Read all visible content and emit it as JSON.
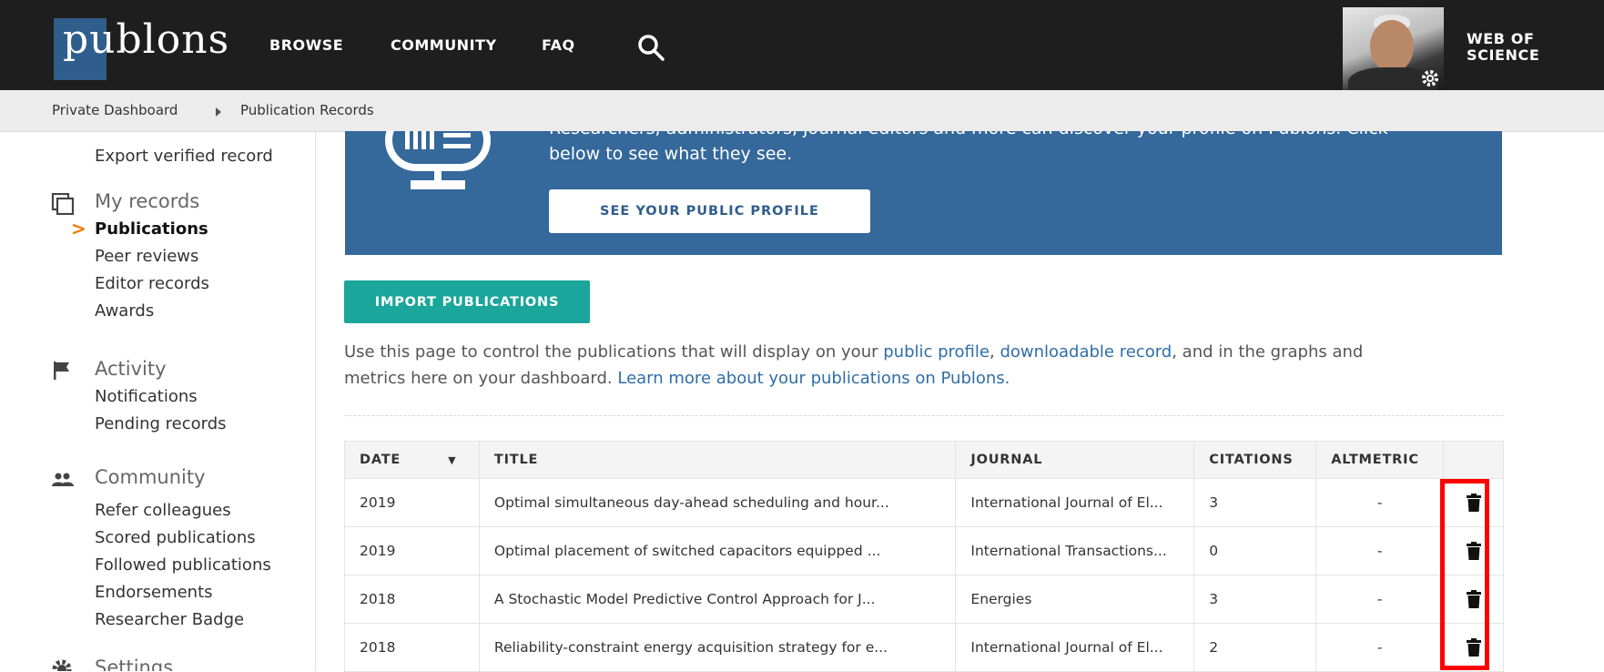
{
  "header": {
    "logo": "publons",
    "nav": [
      "BROWSE",
      "COMMUNITY",
      "FAQ"
    ],
    "web_of_science_line1": "WEB OF",
    "web_of_science_line2": "SCIENCE"
  },
  "breadcrumb": {
    "items": [
      "Private Dashboard",
      "Publication Records"
    ]
  },
  "sidebar": {
    "top_partial": "Export verified record",
    "sections": [
      {
        "title": "My records",
        "icon": "copy-icon",
        "items": [
          "Publications",
          "Peer reviews",
          "Editor records",
          "Awards"
        ],
        "active": "Publications"
      },
      {
        "title": "Activity",
        "icon": "flag-icon",
        "items": [
          "Notifications",
          "Pending records"
        ]
      },
      {
        "title": "Community",
        "icon": "people-icon",
        "items": [
          "Refer colleagues",
          "Scored publications",
          "Followed publications",
          "Endorsements",
          "Researcher Badge"
        ]
      },
      {
        "title": "Settings",
        "icon": "gear-icon",
        "items": []
      }
    ]
  },
  "banner": {
    "text_line1": "Researchers, administrators, journal editors and more can discover your profile on Publons. Click",
    "text_line2": "below to see what they see.",
    "button": "SEE YOUR PUBLIC PROFILE"
  },
  "import_button": "IMPORT PUBLICATIONS",
  "description": {
    "part1": "Use this page to control the publications that will display on your ",
    "link1": "public profile",
    "part2": ", ",
    "link2": "downloadable record",
    "part3": ", and in the graphs and metrics here on your dashboard. ",
    "link3": "Learn more about your publications on Publons."
  },
  "table": {
    "headers": {
      "date": "DATE",
      "title": "TITLE",
      "journal": "JOURNAL",
      "citations": "CITATIONS",
      "altmetric": "ALTMETRIC"
    },
    "rows": [
      {
        "date": "2019",
        "title": "Optimal simultaneous day-ahead scheduling and hour...",
        "journal": "International Journal of El...",
        "citations": "3",
        "altmetric": "-"
      },
      {
        "date": "2019",
        "title": "Optimal placement of switched capacitors equipped ...",
        "journal": "International Transactions...",
        "citations": "0",
        "altmetric": "-"
      },
      {
        "date": "2018",
        "title": "A Stochastic Model Predictive Control Approach for J...",
        "journal": "Energies",
        "citations": "3",
        "altmetric": "-"
      },
      {
        "date": "2018",
        "title": "Reliability-constraint energy acquisition strategy for e...",
        "journal": "International Journal of El...",
        "citations": "2",
        "altmetric": "-"
      }
    ]
  },
  "colors": {
    "topbar": "#1e1e1e",
    "banner": "#35689b",
    "import_button": "#1aa69a",
    "active_chevron": "#f07b00",
    "highlight": "#ff0000",
    "link": "#2f6ea8"
  }
}
